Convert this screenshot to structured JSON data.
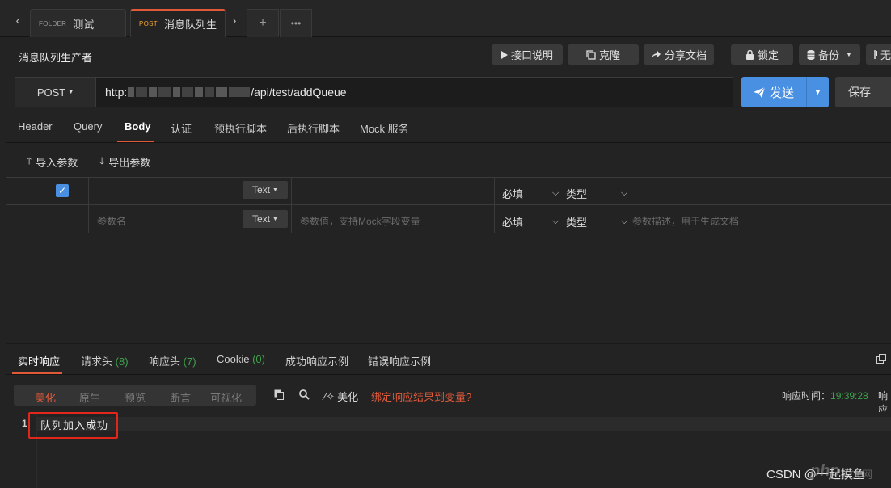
{
  "tabs": [
    {
      "method": "FOLDER",
      "title": "测试"
    },
    {
      "method": "POST",
      "title": "消息队列生…"
    }
  ],
  "api_title": "消息队列生产者",
  "toolbar": {
    "doc_label": "接口说明",
    "clone_label": "克隆",
    "share_label": "分享文档",
    "lock_label": "锁定",
    "backup_label": "备份",
    "extra_label": "无"
  },
  "url_bar": {
    "method": "POST",
    "url_prefix": "http:",
    "url_path": "/api/test/addQueue",
    "send_label": "发送",
    "save_label": "保存"
  },
  "request_tabs": [
    "Header",
    "Query",
    "Body",
    "认证",
    "预执行脚本",
    "后执行脚本",
    "Mock 服务"
  ],
  "params": {
    "import_label": "导入参数",
    "export_label": "导出参数",
    "rows": [
      {
        "name": "",
        "type": "Text",
        "value": "",
        "required": "必填",
        "kind": "类型",
        "desc": ""
      },
      {
        "name_placeholder": "参数名",
        "type": "Text",
        "value_placeholder": "参数值，支持Mock字段变量",
        "required": "必填",
        "kind": "类型",
        "desc_placeholder": "参数描述，用于生成文档"
      }
    ]
  },
  "response": {
    "tabs": [
      {
        "label": "实时响应",
        "count": ""
      },
      {
        "label": "请求头",
        "count": "(8)"
      },
      {
        "label": "响应头",
        "count": "(7)"
      },
      {
        "label": "Cookie",
        "count": "(0)"
      },
      {
        "label": "成功响应示例",
        "count": ""
      },
      {
        "label": "错误响应示例",
        "count": ""
      }
    ],
    "formats": [
      "美化",
      "原生",
      "预览",
      "断言",
      "可视化"
    ],
    "beautify_label": "美化",
    "bind_label": "绑定响应结果到变量?",
    "time_label": "响应时间：",
    "time_value": "19:39:28",
    "trailing_label": "响应",
    "line_number": "1",
    "body_text": "队列加入成功"
  },
  "watermark": {
    "logo": "php",
    "logo_cn": "中文网",
    "text": "CSDN @一起摸鱼"
  }
}
